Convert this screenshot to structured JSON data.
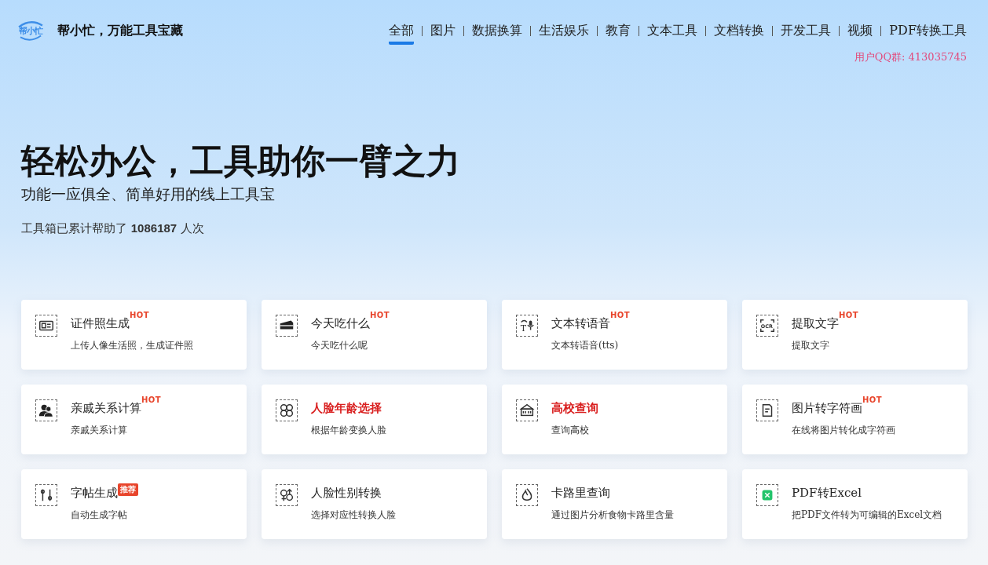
{
  "header": {
    "logo_text": "帮小忙",
    "site_title": "帮小忙，万能工具宝藏"
  },
  "nav": [
    {
      "label": "全部",
      "selected": true
    },
    {
      "label": "图片",
      "selected": false
    },
    {
      "label": "数据换算",
      "selected": false
    },
    {
      "label": "生活娱乐",
      "selected": false
    },
    {
      "label": "教育",
      "selected": false
    },
    {
      "label": "文本工具",
      "selected": false
    },
    {
      "label": "文档转换",
      "selected": false
    },
    {
      "label": "开发工具",
      "selected": false
    },
    {
      "label": "视频",
      "selected": false
    },
    {
      "label": "PDF转换工具",
      "selected": false
    }
  ],
  "qq_group": "用户QQ群: 413035745",
  "hero": {
    "title": "轻松办公，工具助你一臂之力",
    "subtitle": "功能一应俱全、简单好用的线上工具宝",
    "stats": "工具箱已累计帮助了 **1086187** 人次"
  },
  "tools": [
    {
      "title": "证件照生成",
      "description": "上传人像生活照，生成证件照",
      "highlighted": false,
      "badge": {
        "kind": "hot",
        "text": "HOT"
      }
    },
    {
      "title": "今天吃什么",
      "description": "今天吃什么呢",
      "highlighted": false,
      "badge": {
        "kind": "hot",
        "text": "HOT"
      }
    },
    {
      "title": "文本转语音",
      "description": "文本转语音(tts)",
      "icon_text": "T",
      "highlighted": false,
      "badge": {
        "kind": "hot",
        "text": "HOT"
      }
    },
    {
      "title": "提取文字",
      "description": "提取文字",
      "icon_text": "OCR",
      "highlighted": false,
      "badge": {
        "kind": "hot",
        "text": "HOT"
      }
    },
    {
      "title": "亲戚关系计算",
      "description": "亲戚关系计算",
      "highlighted": false,
      "badge": {
        "kind": "hot",
        "text": "HOT"
      }
    },
    {
      "title": "人脸年龄选择",
      "description": "根据年龄变换人脸",
      "highlighted": true
    },
    {
      "title": "高校查询",
      "description": "查询高校",
      "highlighted": true
    },
    {
      "title": "图片转字符画",
      "description": "在线将图片转化成字符画",
      "highlighted": false,
      "badge": {
        "kind": "hot",
        "text": "HOT"
      }
    },
    {
      "title": "字帖生成",
      "description": "自动生成字帖",
      "highlighted": false,
      "badge": {
        "kind": "recommend",
        "text": "推荐"
      }
    },
    {
      "title": "人脸性别转换",
      "description": "选择对应性转换人脸",
      "highlighted": false
    },
    {
      "title": "卡路里查询",
      "description": "通过图片分析食物卡路里含量",
      "highlighted": false
    },
    {
      "title": "PDF转Excel",
      "description": "把PDF文件转为可编辑的Excel文档",
      "highlighted": false
    }
  ]
}
